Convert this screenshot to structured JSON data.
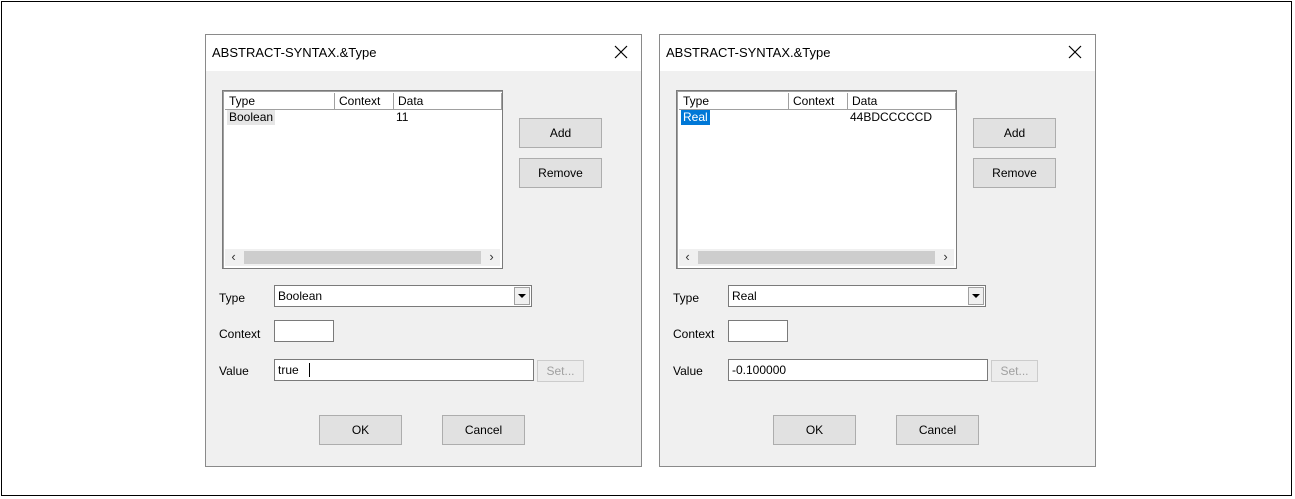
{
  "dialogs": [
    {
      "title": "ABSTRACT-SYNTAX.&Type",
      "list": {
        "columns": [
          "Type",
          "Context",
          "Data"
        ],
        "rows": [
          {
            "type": "Boolean",
            "context": "",
            "data": "11",
            "selected": false
          }
        ]
      },
      "buttons": {
        "add": "Add",
        "remove": "Remove",
        "set": "Set...",
        "ok": "OK",
        "cancel": "Cancel"
      },
      "labels": {
        "type": "Type",
        "context": "Context",
        "value": "Value"
      },
      "type_value": "Boolean",
      "context_value": "",
      "value_value": "true"
    },
    {
      "title": "ABSTRACT-SYNTAX.&Type",
      "list": {
        "columns": [
          "Type",
          "Context",
          "Data"
        ],
        "rows": [
          {
            "type": "Real",
            "context": "",
            "data": "44BDCCCCCD",
            "selected": true
          }
        ]
      },
      "buttons": {
        "add": "Add",
        "remove": "Remove",
        "set": "Set...",
        "ok": "OK",
        "cancel": "Cancel"
      },
      "labels": {
        "type": "Type",
        "context": "Context",
        "value": "Value"
      },
      "type_value": "Real",
      "context_value": "",
      "value_value": "-0.100000"
    }
  ],
  "icons": {
    "close": "close-icon",
    "scroll_left": "chevron-left-icon",
    "scroll_right": "chevron-right-icon",
    "dropdown": "chevron-down-icon"
  },
  "colors": {
    "selection": "#0078d7",
    "dialog_bg": "#f0f0f0",
    "button_bg": "#e1e1e1"
  }
}
